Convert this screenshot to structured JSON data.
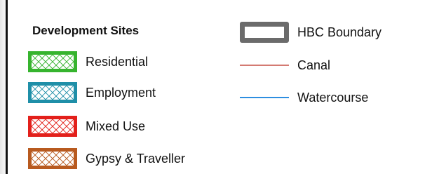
{
  "legend": {
    "heading": "Development Sites",
    "site_types": [
      {
        "label": "Residential",
        "color": "#36b42e",
        "icon": "hatched-residential-swatch"
      },
      {
        "label": "Employment",
        "color": "#1f8fa8",
        "icon": "hatched-employment-swatch"
      },
      {
        "label": "Mixed Use",
        "color": "#e3201b",
        "icon": "hatched-mixed-use-swatch"
      },
      {
        "label": "Gypsy & Traveller",
        "color": "#b85a1f",
        "icon": "hatched-gypsy-traveller-swatch"
      }
    ],
    "features": [
      {
        "label": "HBC Boundary",
        "color": "#6b6b6b",
        "icon": "boundary-outline-symbol"
      },
      {
        "label": "Canal",
        "color": "#d47a72",
        "icon": "canal-line-symbol"
      },
      {
        "label": "Watercourse",
        "color": "#2d8ee0",
        "icon": "watercourse-line-symbol"
      }
    ]
  }
}
